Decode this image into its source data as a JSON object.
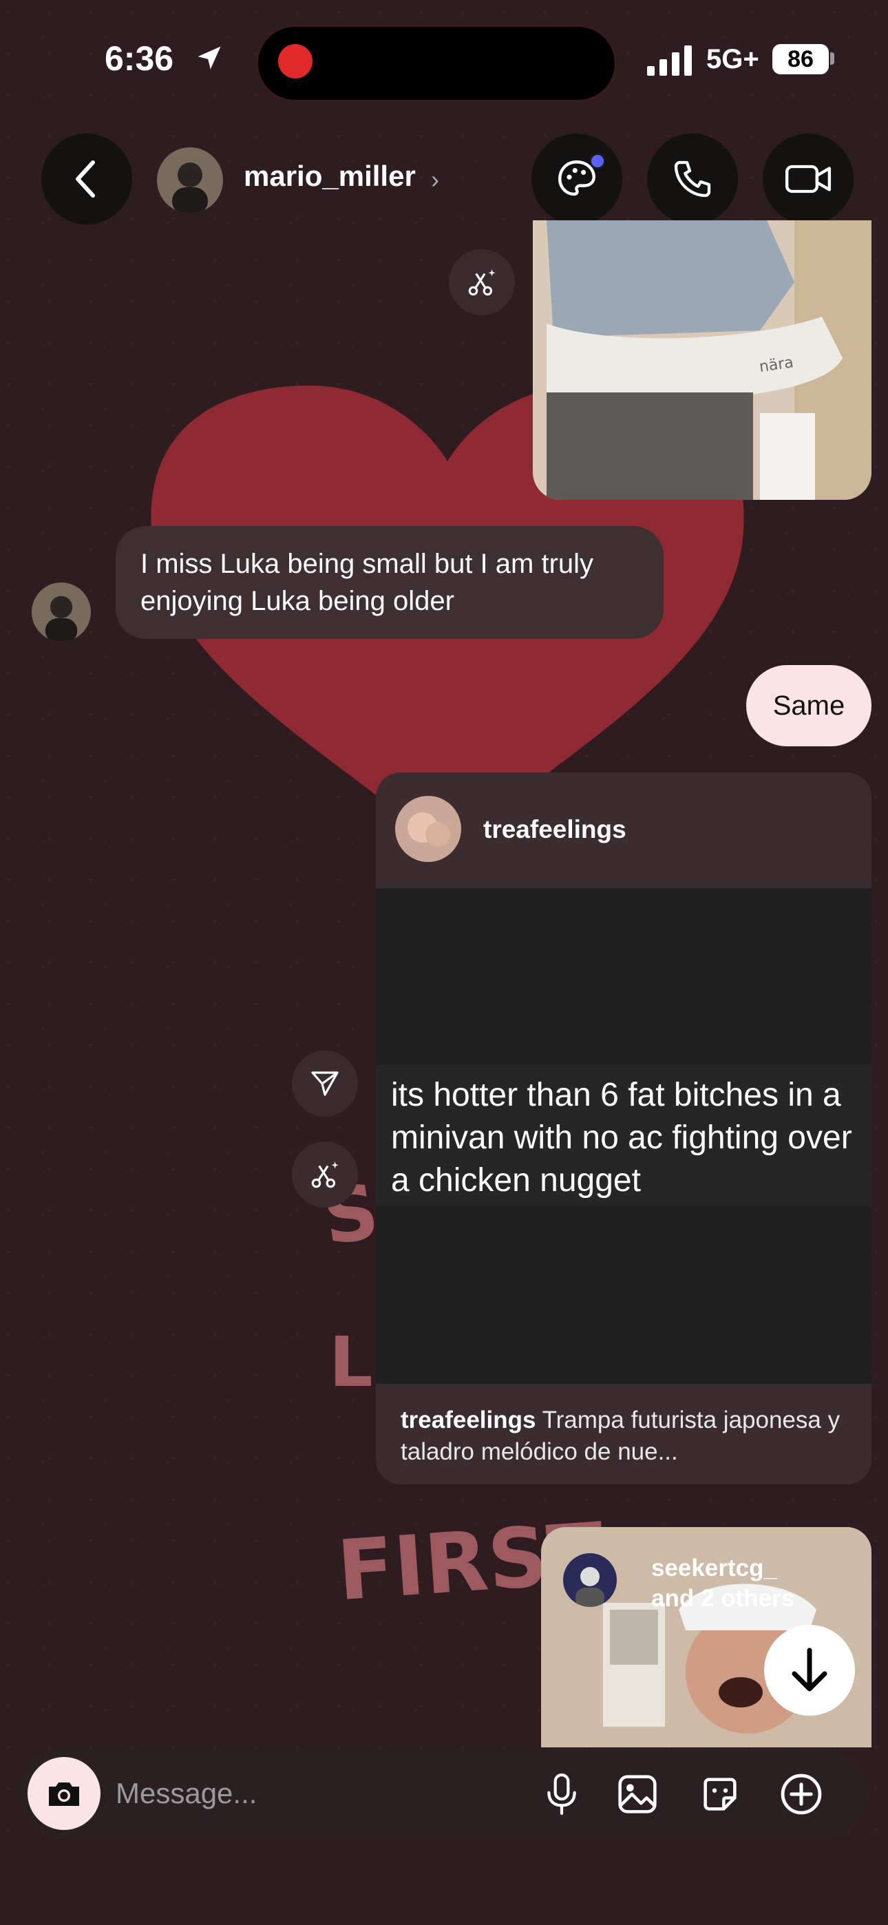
{
  "status_bar": {
    "time": "6:36",
    "network": "5G+",
    "battery": "86"
  },
  "header": {
    "username": "mario_miller",
    "chevron": "›"
  },
  "messages": {
    "received_1": "I miss Luka being small but I am truly enjoying Luka being older",
    "sent_1": "Same"
  },
  "shared_post": {
    "author": "treafeelings",
    "text": "its hotter than 6 fat bitches in a minivan with no ac fighting over a chicken nugget",
    "caption_author": "treafeelings",
    "caption": "Trampa futurista japonesa y taladro melódico de nue..."
  },
  "shared_reel": {
    "author": "seekertcg_",
    "others": "and 2 others"
  },
  "stickers": {
    "first": "FIRST"
  },
  "composer": {
    "placeholder": "Message..."
  },
  "colors": {
    "background": "#2f1c20",
    "heart": "#8f2a33",
    "sent_bubble": "#fbe3e6",
    "received_bubble": "#3d2f32",
    "accent_dot": "#5b63ff"
  }
}
